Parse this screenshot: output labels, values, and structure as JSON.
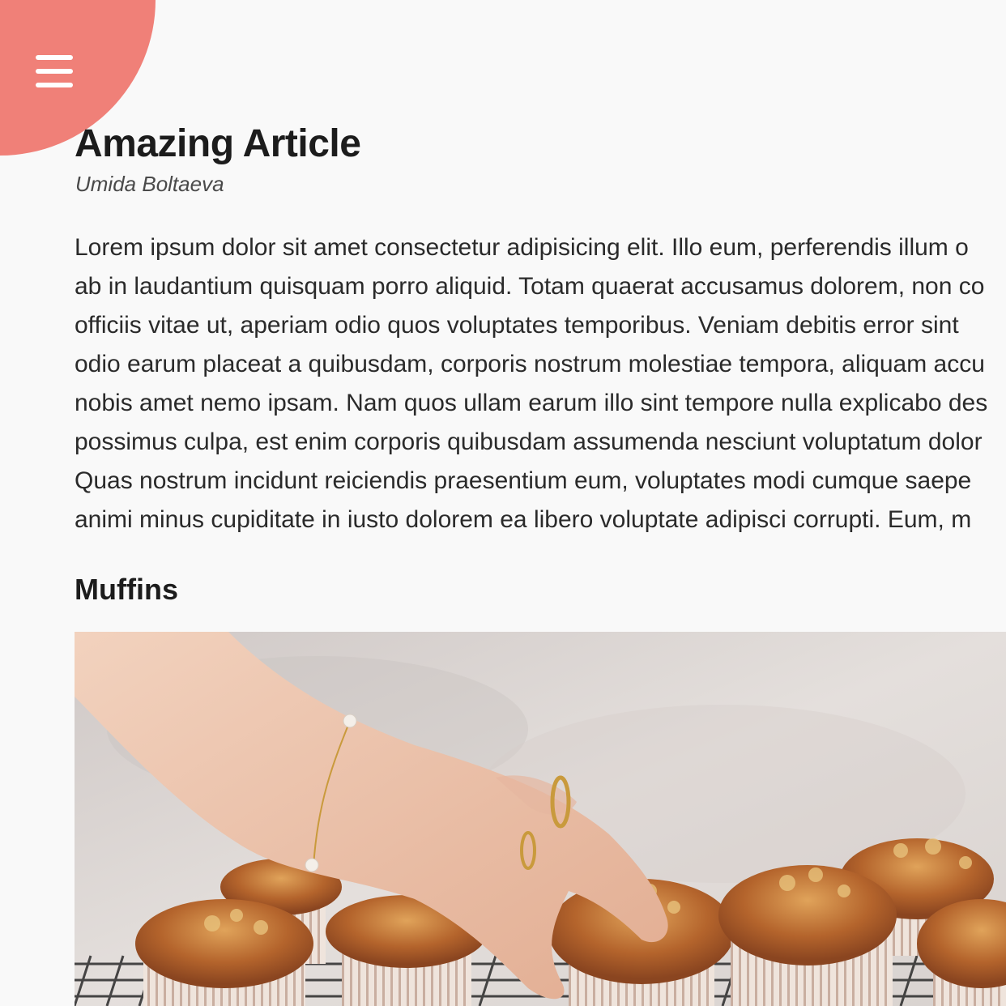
{
  "menu": {
    "icon": "hamburger-menu-icon",
    "accent_color": "#f08078"
  },
  "article": {
    "title": "Amazing Article",
    "author": "Umida Boltaeva",
    "body_lines": [
      "Lorem ipsum dolor sit amet consectetur adipisicing elit. Illo eum, perferendis illum o",
      "ab in laudantium quisquam porro aliquid. Totam quaerat accusamus dolorem, non co",
      "officiis vitae ut, aperiam odio quos voluptates temporibus. Veniam debitis error sint",
      "odio earum placeat a quibusdam, corporis nostrum molestiae tempora, aliquam accu",
      "nobis amet nemo ipsam. Nam quos ullam earum illo sint tempore nulla explicabo des",
      "possimus culpa, est enim corporis quibusdam assumenda nesciunt voluptatum dolor",
      "Quas nostrum incidunt reiciendis praesentium eum, voluptates modi cumque saepe",
      "animi minus cupiditate in iusto dolorem ea libero voluptate adipisci corrupti. Eum, m"
    ],
    "section_heading": "Muffins"
  }
}
